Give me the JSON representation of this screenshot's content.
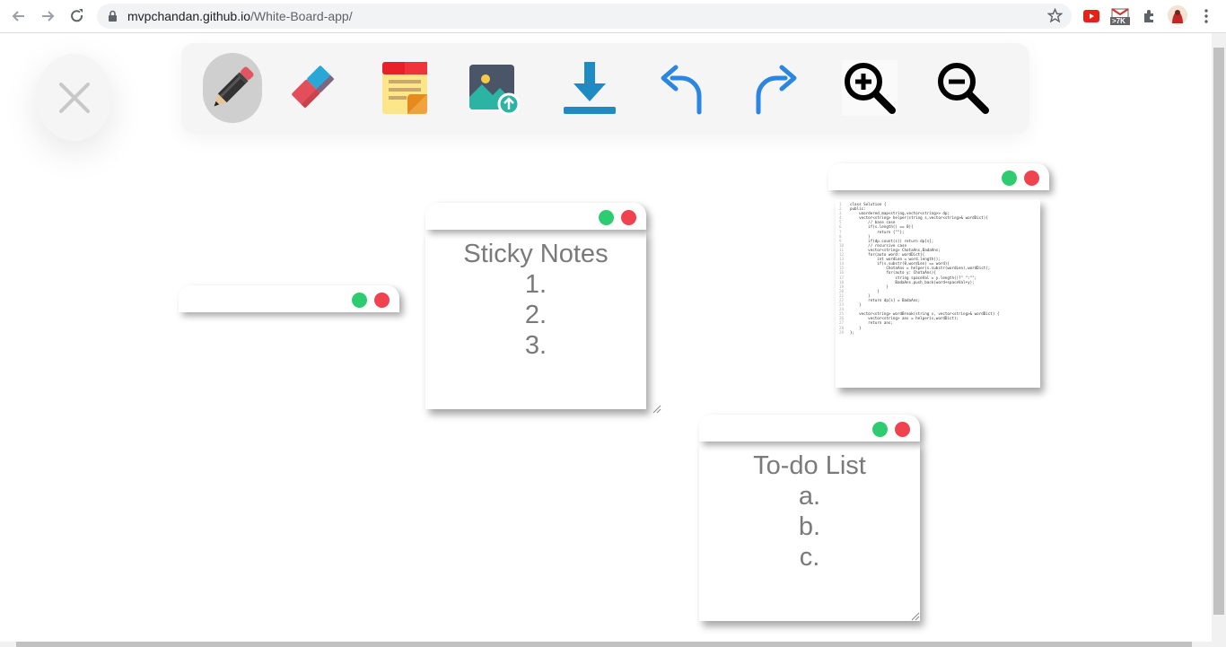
{
  "browser": {
    "url_host": "mvpchandan.github.io",
    "url_path": "/White-Board-app/",
    "ext_badge": ">7K"
  },
  "toolbar": {
    "tools": [
      {
        "name": "pencil-icon",
        "active": true
      },
      {
        "name": "eraser-icon"
      },
      {
        "name": "sticky-note-icon"
      },
      {
        "name": "image-upload-icon"
      },
      {
        "name": "download-icon"
      },
      {
        "name": "undo-icon"
      },
      {
        "name": "redo-icon"
      },
      {
        "name": "zoom-in-icon"
      },
      {
        "name": "zoom-out-icon"
      }
    ]
  },
  "notes": {
    "sticky": {
      "title": "Sticky Notes",
      "lines": [
        "1.",
        "2.",
        "3."
      ]
    },
    "todo": {
      "title": "To-do List",
      "lines": [
        "a.",
        "b.",
        "c."
      ]
    }
  },
  "code_image": {
    "lines": [
      "class Solution {",
      "public:",
      "    unordered_map<string,vector<string>> dp;",
      "    vector<string> helper(string s,vector<string>& wordDict){",
      "        // base case",
      "        if(s.length() == 0){",
      "            return {\"\"};",
      "        }",
      "        if(dp.count(s)) return dp[s];",
      "        // recursive case",
      "        vector<string> ChotaAns,BadaAns;",
      "        for(auto word: wordDict){",
      "            int wordLen = word.length();",
      "            if(s.substr(0,wordLen) == word){",
      "                ChotaAns = helper(s.substr(wordLen),wordDict);",
      "                for(auto y: ChotaAns){",
      "                    string spaceVal = y.length()?\" \":\"\";",
      "                    BadaAns.push_back(word+spaceVal+y);",
      "                }",
      "            }",
      "        }",
      "        return dp[s] = BadaAns;",
      "    }",
      "",
      "    vector<string> wordBreak(string s, vector<string>& wordDict) {",
      "        vector<string> ans = helper(s,wordDict);",
      "        return ans;",
      "    }",
      "};"
    ]
  },
  "colors": {
    "dot_green": "#2ecc71",
    "dot_red": "#f0424f",
    "accent_blue": "#2a86e0"
  }
}
